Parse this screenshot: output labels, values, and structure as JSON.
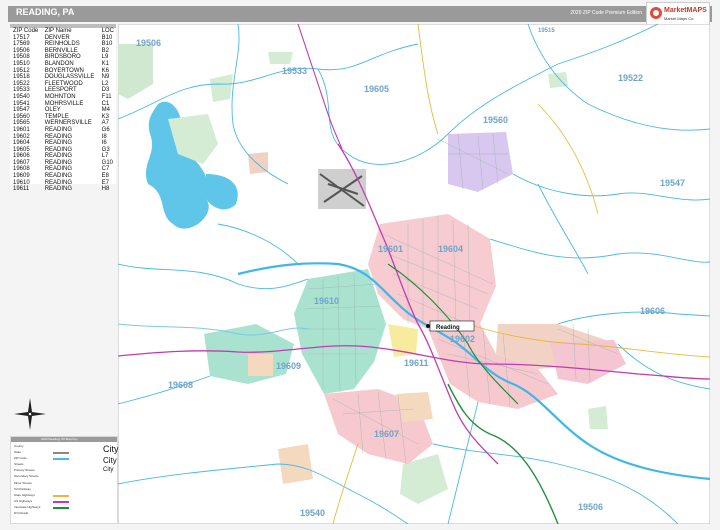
{
  "header": {
    "title": "READING, PA",
    "edition": "2026 ZIP Code Premium Edition",
    "logo_text": "MarketMAPS",
    "logo_sub": "Market Maps Co."
  },
  "zip_table": {
    "headers": [
      "ZIP Code",
      "ZIP Name",
      "LOC"
    ],
    "rows": [
      [
        "17517",
        "DENVER",
        "B10"
      ],
      [
        "17569",
        "REINHOLDS",
        "B10"
      ],
      [
        "19506",
        "BERNVILLE",
        "B2"
      ],
      [
        "19508",
        "BIRDSBORO",
        "L9"
      ],
      [
        "19510",
        "BLANDON",
        "K1"
      ],
      [
        "19512",
        "BOYERTOWN",
        "K6"
      ],
      [
        "19518",
        "DOUGLASSVILLE",
        "N9"
      ],
      [
        "19522",
        "FLEETWOOD",
        "L2"
      ],
      [
        "19533",
        "LEESPORT",
        "D3"
      ],
      [
        "19540",
        "MOHNTON",
        "F11"
      ],
      [
        "19541",
        "MOHRSVILLE",
        "C1"
      ],
      [
        "19547",
        "OLEY",
        "M4"
      ],
      [
        "19560",
        "TEMPLE",
        "K3"
      ],
      [
        "19565",
        "WERNERSVILLE",
        "A7"
      ],
      [
        "19601",
        "READING",
        "G6"
      ],
      [
        "19602",
        "READING",
        "I8"
      ],
      [
        "19604",
        "READING",
        "I6"
      ],
      [
        "19605",
        "READING",
        "G3"
      ],
      [
        "19606",
        "READING",
        "L7"
      ],
      [
        "19607",
        "READING",
        "G10"
      ],
      [
        "19608",
        "READING",
        "C7"
      ],
      [
        "19609",
        "READING",
        "E8"
      ],
      [
        "19610",
        "READING",
        "E7"
      ],
      [
        "19611",
        "READING",
        "H8"
      ]
    ]
  },
  "map": {
    "city": "Reading",
    "zip_labels": [
      {
        "text": "19506",
        "zone": "nw"
      },
      {
        "text": "19533",
        "zone": "n1"
      },
      {
        "text": "19605",
        "zone": "n2"
      },
      {
        "text": "19522",
        "zone": "ne"
      },
      {
        "text": "19560",
        "zone": "ne2"
      },
      {
        "text": "19547",
        "zone": "e"
      },
      {
        "text": "19601",
        "zone": "c1"
      },
      {
        "text": "19604",
        "zone": "c2"
      },
      {
        "text": "19610",
        "zone": "w"
      },
      {
        "text": "19602",
        "zone": "c3"
      },
      {
        "text": "19606",
        "zone": "e2"
      },
      {
        "text": "19609",
        "zone": "sw"
      },
      {
        "text": "19611",
        "zone": "s1"
      },
      {
        "text": "19608",
        "zone": "sw2"
      },
      {
        "text": "19607",
        "zone": "s2"
      },
      {
        "text": "19540",
        "zone": "s3"
      },
      {
        "text": "19506",
        "zone": "se"
      },
      {
        "text": "19515",
        "zone": "nn"
      }
    ]
  },
  "legend": {
    "title": "2026 Reading, PA Map Key",
    "rows": [
      "County",
      "State",
      "ZIP Code",
      "Streets",
      "Primary Streets",
      "Secondary Streets",
      "Minor Streets",
      "Toll Parkway",
      "State Highways",
      "US Highways",
      "Interstate Highways",
      "Dirt Roads"
    ],
    "city_samples": [
      "City",
      "City",
      "City"
    ],
    "colors": {
      "zip": "#47b9e6",
      "us": "#c23bb0",
      "interstate": "#1f8f3a",
      "state": "#e8b93a"
    }
  }
}
